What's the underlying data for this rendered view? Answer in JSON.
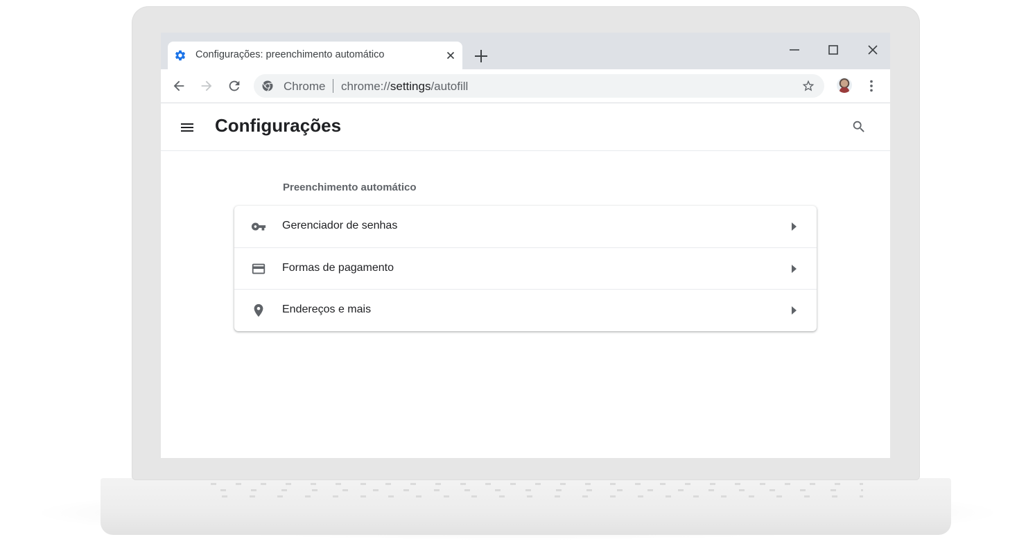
{
  "tab": {
    "title": "Configurações: preenchimento automático",
    "icon": "gear-icon",
    "accent": "#1a73e8"
  },
  "omnibox": {
    "site_label": "Chrome",
    "url_scheme": "chrome://",
    "url_host": "settings",
    "url_path": "/autofill"
  },
  "header": {
    "title": "Configurações"
  },
  "section": {
    "title": "Preenchimento automático",
    "items": [
      {
        "label": "Gerenciador de senhas",
        "icon": "key-icon"
      },
      {
        "label": "Formas de pagamento",
        "icon": "credit-card-icon"
      },
      {
        "label": "Endereços e mais",
        "icon": "location-pin-icon"
      }
    ]
  },
  "colors": {
    "tabstrip": "#dee1e6",
    "omnibox": "#f1f3f4",
    "text_primary": "#202124",
    "text_secondary": "#5f6368"
  }
}
